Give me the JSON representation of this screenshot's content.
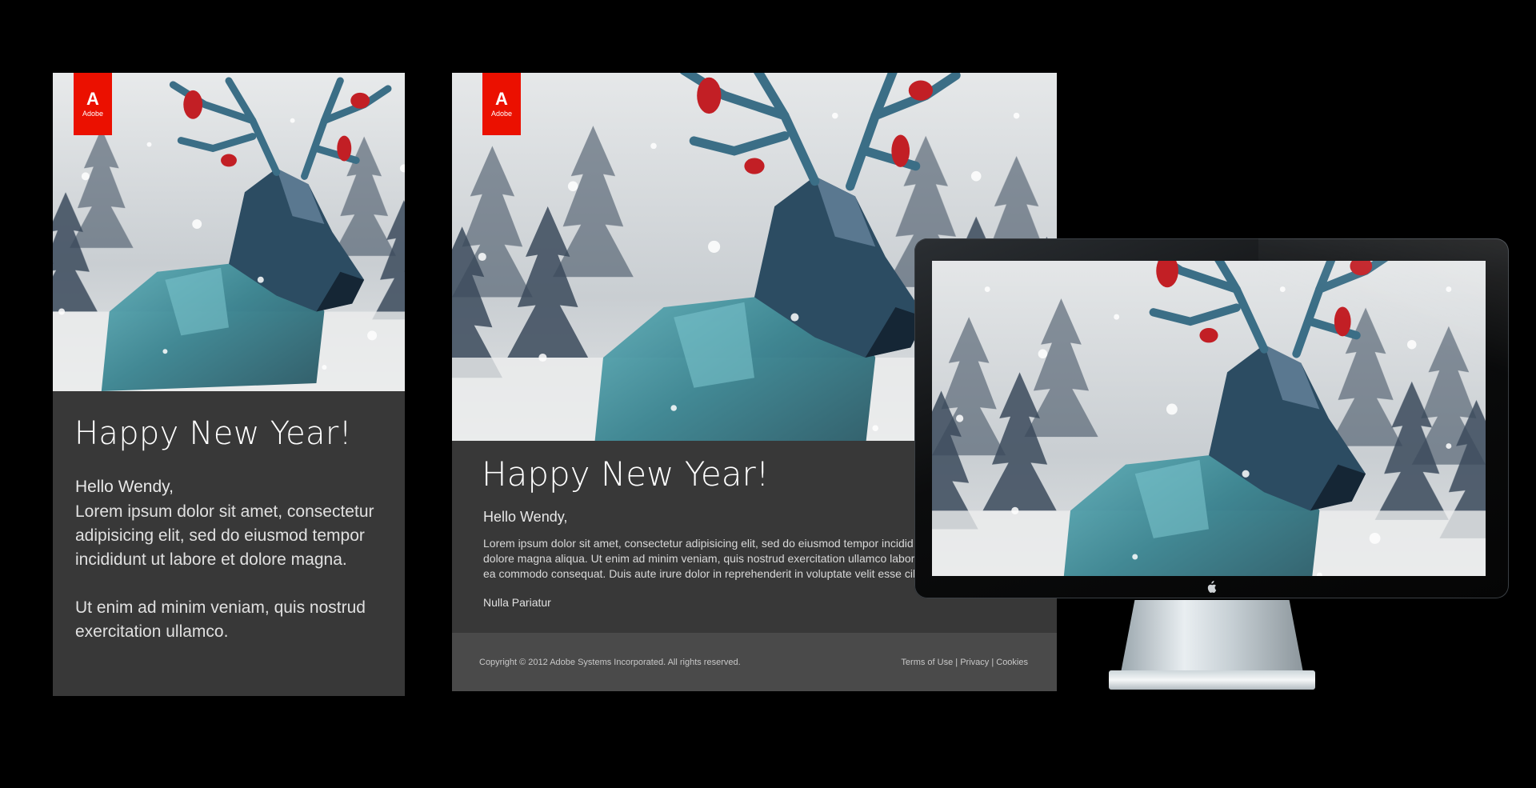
{
  "logo": {
    "mark": "A",
    "word": "Adobe"
  },
  "mobile": {
    "title": "Happy New Year!",
    "greeting": "Hello Wendy,",
    "paragraph1": "Lorem ipsum dolor sit amet, consectetur adipisicing elit, sed do eiusmod tempor incididunt ut labore et dolore magna.",
    "paragraph2": "Ut enim ad minim veniam, quis nostrud exercitation ullamco."
  },
  "desktop": {
    "title": "Happy New Year!",
    "greeting": "Hello Wendy,",
    "body_line1": "Lorem ipsum dolor sit amet, consectetur adipisicing elit, sed do eiusmod tempor incidid",
    "body_line2": "dolore magna aliqua. Ut enim ad minim veniam, quis nostrud exercitation ullamco labori",
    "body_line3": "ea commodo consequat. Duis aute irure dolor in reprehenderit in voluptate velit esse cill",
    "signoff": "Nulla Pariatur",
    "footer": {
      "copyright": "Copyright © 2012 Adobe Systems Incorporated. All rights reserved.",
      "link_terms": "Terms of Use",
      "link_privacy": "Privacy",
      "link_cookies": "Cookies",
      "separator": "|"
    }
  },
  "monitor": {
    "logo_icon": "apple-icon"
  },
  "colors": {
    "background": "#000000",
    "panel": "#383838",
    "footer": "#4a4a4a",
    "adobe_red": "#eb1000",
    "deer_teal": "#3f8f9a",
    "cardinal_red": "#c21f25"
  }
}
